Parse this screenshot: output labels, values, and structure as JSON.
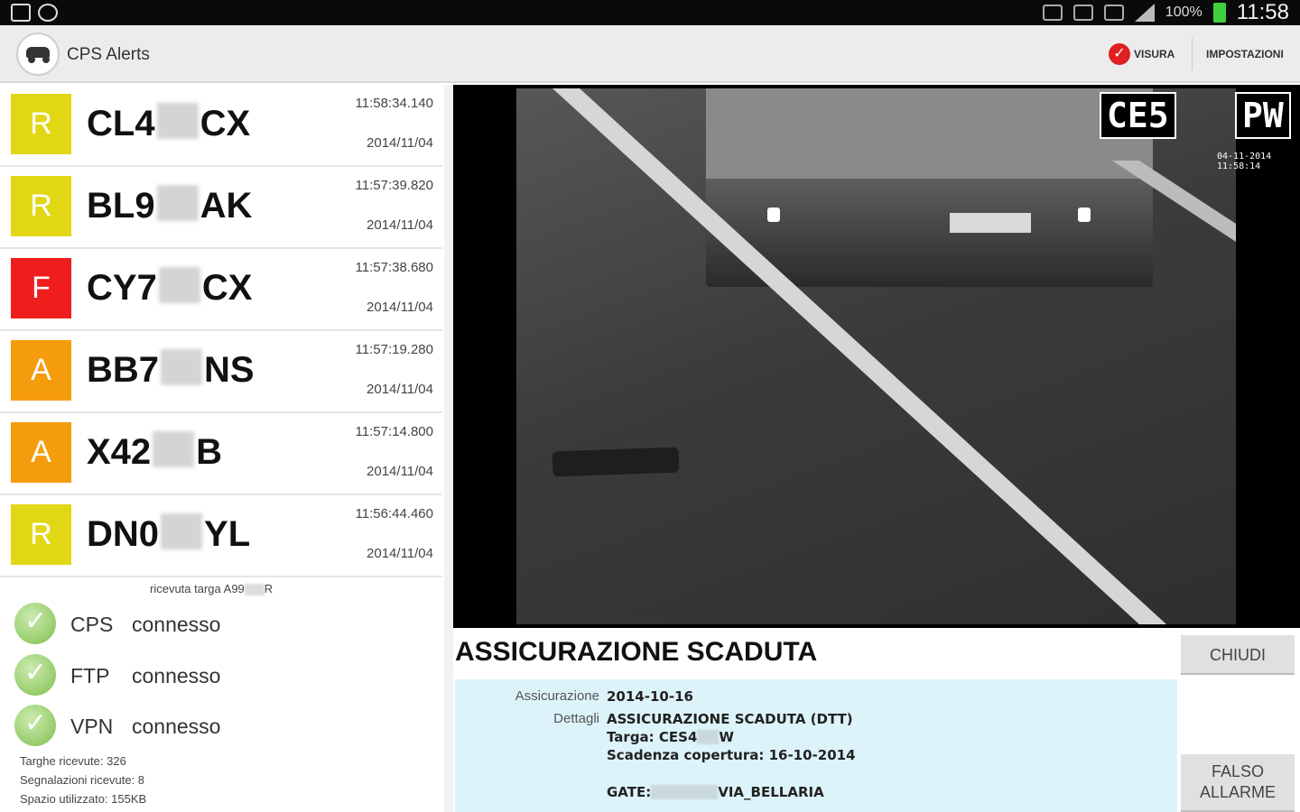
{
  "status_bar": {
    "battery": "100%",
    "time": "11:58",
    "colors": {
      "battery": "#3fcf3f"
    }
  },
  "action_bar": {
    "app_title": "CPS Alerts",
    "visura_label": "VISURA",
    "impostazioni_label": "IMPOSTAZIONI",
    "icons": [
      "car-logo-icon",
      "visura-check-icon"
    ]
  },
  "alerts": [
    {
      "badge": "R",
      "badge_color": "#e2d714",
      "plate_prefix": "CL4",
      "plate_suffix": "CX",
      "time": "11:58:34.140",
      "date": "2014/11/04"
    },
    {
      "badge": "R",
      "badge_color": "#e2d714",
      "plate_prefix": "BL9",
      "plate_suffix": "AK",
      "time": "11:57:39.820",
      "date": "2014/11/04"
    },
    {
      "badge": "F",
      "badge_color": "#ef1d1d",
      "plate_prefix": "CY7",
      "plate_suffix": "CX",
      "time": "11:57:38.680",
      "date": "2014/11/04"
    },
    {
      "badge": "A",
      "badge_color": "#f59c0d",
      "plate_prefix": "BB7",
      "plate_suffix": "NS",
      "time": "11:57:19.280",
      "date": "2014/11/04"
    },
    {
      "badge": "A",
      "badge_color": "#f59c0d",
      "plate_prefix": "X42",
      "plate_suffix": "B",
      "time": "11:57:14.800",
      "date": "2014/11/04"
    },
    {
      "badge": "R",
      "badge_color": "#e2d714",
      "plate_prefix": "DN0",
      "plate_suffix": "YL",
      "time": "11:56:44.460",
      "date": "2014/11/04"
    }
  ],
  "status": {
    "received_prefix": "ricevuta targa A99",
    "received_suffix": "R",
    "connections": [
      {
        "name": "CPS",
        "state": "connesso"
      },
      {
        "name": "FTP",
        "state": "connesso"
      },
      {
        "name": "VPN",
        "state": "connesso"
      }
    ],
    "stats": [
      "Targhe ricevute: 326",
      "Segnalazioni ricevute: 8",
      "Spazio utilizzato: 155KB"
    ]
  },
  "camera": {
    "ocr_left": "CE5",
    "ocr_right": "PW",
    "stamp_line1": "04-11-2014",
    "stamp_line2": "11:58:14"
  },
  "detail": {
    "title": "ASSICURAZIONE SCADUTA",
    "close_label": "CHIUDI",
    "false_alarm_line1": "FALSO",
    "false_alarm_line2": "ALLARME",
    "assicurazione_label": "Assicurazione",
    "assicurazione_value": "2014-10-16",
    "dettagli_label": "Dettagli",
    "dettagli_line1": "ASSICURAZIONE SCADUTA (DTT)",
    "targa_prefix": "Targa: CES4",
    "targa_suffix": "W",
    "scadenza": "Scadenza copertura: 16-10-2014",
    "gate_prefix": "GATE:",
    "gate_suffix": "VIA_BELLARIA"
  }
}
